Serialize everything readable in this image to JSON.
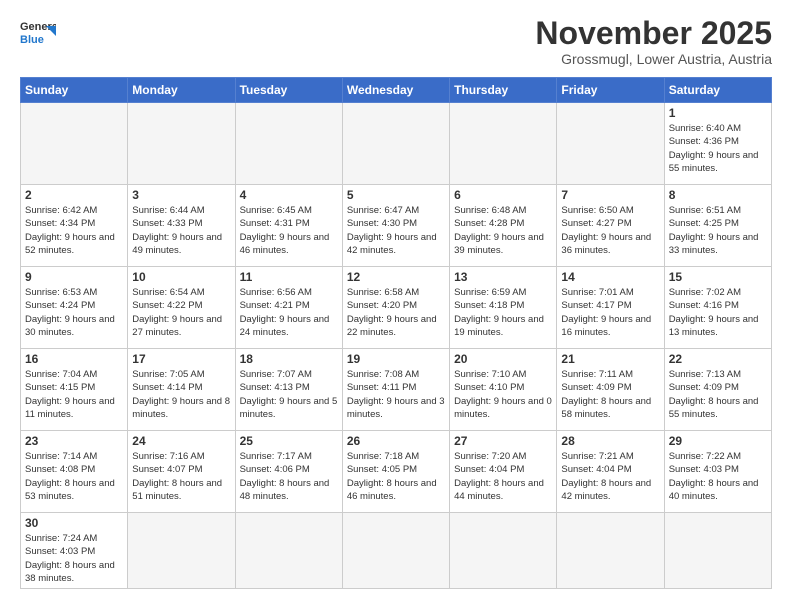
{
  "header": {
    "logo_general": "General",
    "logo_blue": "Blue",
    "month_title": "November 2025",
    "location": "Grossmugl, Lower Austria, Austria"
  },
  "weekdays": [
    "Sunday",
    "Monday",
    "Tuesday",
    "Wednesday",
    "Thursday",
    "Friday",
    "Saturday"
  ],
  "weeks": [
    [
      {
        "day": "",
        "info": ""
      },
      {
        "day": "",
        "info": ""
      },
      {
        "day": "",
        "info": ""
      },
      {
        "day": "",
        "info": ""
      },
      {
        "day": "",
        "info": ""
      },
      {
        "day": "",
        "info": ""
      },
      {
        "day": "1",
        "info": "Sunrise: 6:40 AM\nSunset: 4:36 PM\nDaylight: 9 hours\nand 55 minutes."
      }
    ],
    [
      {
        "day": "2",
        "info": "Sunrise: 6:42 AM\nSunset: 4:34 PM\nDaylight: 9 hours\nand 52 minutes."
      },
      {
        "day": "3",
        "info": "Sunrise: 6:44 AM\nSunset: 4:33 PM\nDaylight: 9 hours\nand 49 minutes."
      },
      {
        "day": "4",
        "info": "Sunrise: 6:45 AM\nSunset: 4:31 PM\nDaylight: 9 hours\nand 46 minutes."
      },
      {
        "day": "5",
        "info": "Sunrise: 6:47 AM\nSunset: 4:30 PM\nDaylight: 9 hours\nand 42 minutes."
      },
      {
        "day": "6",
        "info": "Sunrise: 6:48 AM\nSunset: 4:28 PM\nDaylight: 9 hours\nand 39 minutes."
      },
      {
        "day": "7",
        "info": "Sunrise: 6:50 AM\nSunset: 4:27 PM\nDaylight: 9 hours\nand 36 minutes."
      },
      {
        "day": "8",
        "info": "Sunrise: 6:51 AM\nSunset: 4:25 PM\nDaylight: 9 hours\nand 33 minutes."
      }
    ],
    [
      {
        "day": "9",
        "info": "Sunrise: 6:53 AM\nSunset: 4:24 PM\nDaylight: 9 hours\nand 30 minutes."
      },
      {
        "day": "10",
        "info": "Sunrise: 6:54 AM\nSunset: 4:22 PM\nDaylight: 9 hours\nand 27 minutes."
      },
      {
        "day": "11",
        "info": "Sunrise: 6:56 AM\nSunset: 4:21 PM\nDaylight: 9 hours\nand 24 minutes."
      },
      {
        "day": "12",
        "info": "Sunrise: 6:58 AM\nSunset: 4:20 PM\nDaylight: 9 hours\nand 22 minutes."
      },
      {
        "day": "13",
        "info": "Sunrise: 6:59 AM\nSunset: 4:18 PM\nDaylight: 9 hours\nand 19 minutes."
      },
      {
        "day": "14",
        "info": "Sunrise: 7:01 AM\nSunset: 4:17 PM\nDaylight: 9 hours\nand 16 minutes."
      },
      {
        "day": "15",
        "info": "Sunrise: 7:02 AM\nSunset: 4:16 PM\nDaylight: 9 hours\nand 13 minutes."
      }
    ],
    [
      {
        "day": "16",
        "info": "Sunrise: 7:04 AM\nSunset: 4:15 PM\nDaylight: 9 hours\nand 11 minutes."
      },
      {
        "day": "17",
        "info": "Sunrise: 7:05 AM\nSunset: 4:14 PM\nDaylight: 9 hours\nand 8 minutes."
      },
      {
        "day": "18",
        "info": "Sunrise: 7:07 AM\nSunset: 4:13 PM\nDaylight: 9 hours\nand 5 minutes."
      },
      {
        "day": "19",
        "info": "Sunrise: 7:08 AM\nSunset: 4:11 PM\nDaylight: 9 hours\nand 3 minutes."
      },
      {
        "day": "20",
        "info": "Sunrise: 7:10 AM\nSunset: 4:10 PM\nDaylight: 9 hours\nand 0 minutes."
      },
      {
        "day": "21",
        "info": "Sunrise: 7:11 AM\nSunset: 4:09 PM\nDaylight: 8 hours\nand 58 minutes."
      },
      {
        "day": "22",
        "info": "Sunrise: 7:13 AM\nSunset: 4:09 PM\nDaylight: 8 hours\nand 55 minutes."
      }
    ],
    [
      {
        "day": "23",
        "info": "Sunrise: 7:14 AM\nSunset: 4:08 PM\nDaylight: 8 hours\nand 53 minutes."
      },
      {
        "day": "24",
        "info": "Sunrise: 7:16 AM\nSunset: 4:07 PM\nDaylight: 8 hours\nand 51 minutes."
      },
      {
        "day": "25",
        "info": "Sunrise: 7:17 AM\nSunset: 4:06 PM\nDaylight: 8 hours\nand 48 minutes."
      },
      {
        "day": "26",
        "info": "Sunrise: 7:18 AM\nSunset: 4:05 PM\nDaylight: 8 hours\nand 46 minutes."
      },
      {
        "day": "27",
        "info": "Sunrise: 7:20 AM\nSunset: 4:04 PM\nDaylight: 8 hours\nand 44 minutes."
      },
      {
        "day": "28",
        "info": "Sunrise: 7:21 AM\nSunset: 4:04 PM\nDaylight: 8 hours\nand 42 minutes."
      },
      {
        "day": "29",
        "info": "Sunrise: 7:22 AM\nSunset: 4:03 PM\nDaylight: 8 hours\nand 40 minutes."
      }
    ],
    [
      {
        "day": "30",
        "info": "Sunrise: 7:24 AM\nSunset: 4:03 PM\nDaylight: 8 hours\nand 38 minutes."
      },
      {
        "day": "",
        "info": ""
      },
      {
        "day": "",
        "info": ""
      },
      {
        "day": "",
        "info": ""
      },
      {
        "day": "",
        "info": ""
      },
      {
        "day": "",
        "info": ""
      },
      {
        "day": "",
        "info": ""
      }
    ]
  ]
}
